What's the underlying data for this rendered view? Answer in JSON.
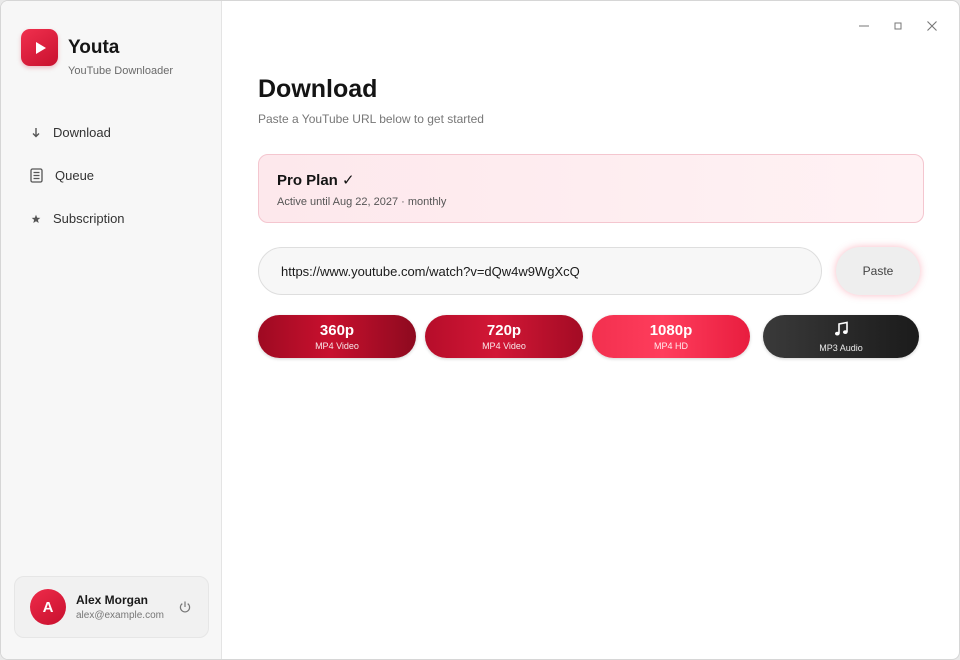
{
  "app": {
    "name": "Youta",
    "subtitle": "YouTube Downloader"
  },
  "sidebar": {
    "items": [
      {
        "label": "Download",
        "icon": "download-icon"
      },
      {
        "label": "Queue",
        "icon": "queue-icon"
      },
      {
        "label": "Subscription",
        "icon": "star-icon"
      }
    ]
  },
  "user": {
    "initial": "A",
    "name": "Alex Morgan",
    "email": "alex@example.com"
  },
  "page": {
    "title": "Download",
    "subtitle": "Paste a YouTube URL below to get started"
  },
  "plan": {
    "title": "Pro Plan ✓",
    "status": "Active until Aug 22, 2027 · monthly"
  },
  "url": {
    "value": "https://www.youtube.com/watch?v=dQw4w9WgXcQ"
  },
  "paste_label": "Paste",
  "formats": [
    {
      "label": "360p",
      "sub": "MP4 Video"
    },
    {
      "label": "720p",
      "sub": "MP4 Video"
    },
    {
      "label": "1080p",
      "sub": "MP4 HD"
    },
    {
      "label": "",
      "sub": "MP3 Audio",
      "icon": "music-note-icon"
    }
  ],
  "colors": {
    "accent": "#c8102e",
    "accent_light": "#ff3d5c",
    "dark_button": "#2a2a2a"
  }
}
